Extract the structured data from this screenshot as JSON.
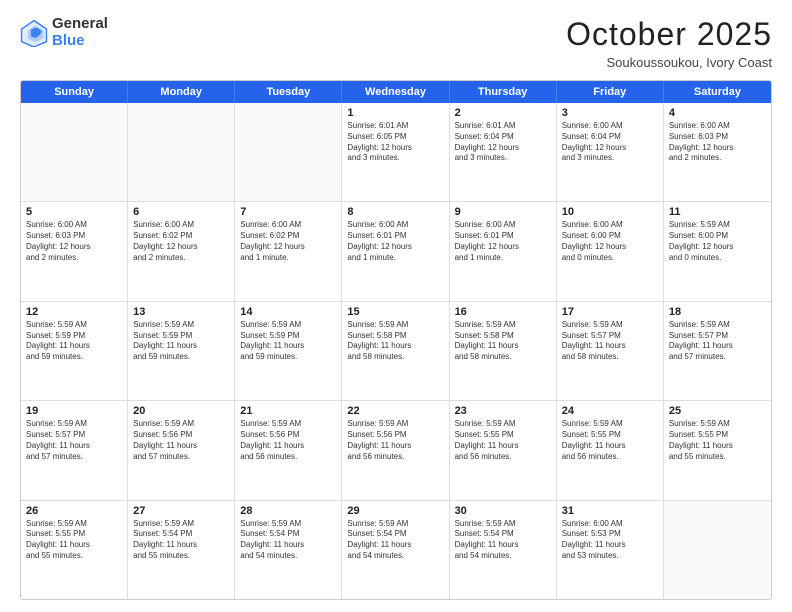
{
  "header": {
    "logo_general": "General",
    "logo_blue": "Blue",
    "month_title": "October 2025",
    "subtitle": "Soukoussoukou, Ivory Coast"
  },
  "weekdays": [
    "Sunday",
    "Monday",
    "Tuesday",
    "Wednesday",
    "Thursday",
    "Friday",
    "Saturday"
  ],
  "rows": [
    [
      {
        "date": "",
        "info": ""
      },
      {
        "date": "",
        "info": ""
      },
      {
        "date": "",
        "info": ""
      },
      {
        "date": "1",
        "info": "Sunrise: 6:01 AM\nSunset: 6:05 PM\nDaylight: 12 hours\nand 3 minutes."
      },
      {
        "date": "2",
        "info": "Sunrise: 6:01 AM\nSunset: 6:04 PM\nDaylight: 12 hours\nand 3 minutes."
      },
      {
        "date": "3",
        "info": "Sunrise: 6:00 AM\nSunset: 6:04 PM\nDaylight: 12 hours\nand 3 minutes."
      },
      {
        "date": "4",
        "info": "Sunrise: 6:00 AM\nSunset: 6:03 PM\nDaylight: 12 hours\nand 2 minutes."
      }
    ],
    [
      {
        "date": "5",
        "info": "Sunrise: 6:00 AM\nSunset: 6:03 PM\nDaylight: 12 hours\nand 2 minutes."
      },
      {
        "date": "6",
        "info": "Sunrise: 6:00 AM\nSunset: 6:02 PM\nDaylight: 12 hours\nand 2 minutes."
      },
      {
        "date": "7",
        "info": "Sunrise: 6:00 AM\nSunset: 6:02 PM\nDaylight: 12 hours\nand 1 minute."
      },
      {
        "date": "8",
        "info": "Sunrise: 6:00 AM\nSunset: 6:01 PM\nDaylight: 12 hours\nand 1 minute."
      },
      {
        "date": "9",
        "info": "Sunrise: 6:00 AM\nSunset: 6:01 PM\nDaylight: 12 hours\nand 1 minute."
      },
      {
        "date": "10",
        "info": "Sunrise: 6:00 AM\nSunset: 6:00 PM\nDaylight: 12 hours\nand 0 minutes."
      },
      {
        "date": "11",
        "info": "Sunrise: 5:59 AM\nSunset: 6:00 PM\nDaylight: 12 hours\nand 0 minutes."
      }
    ],
    [
      {
        "date": "12",
        "info": "Sunrise: 5:59 AM\nSunset: 5:59 PM\nDaylight: 11 hours\nand 59 minutes."
      },
      {
        "date": "13",
        "info": "Sunrise: 5:59 AM\nSunset: 5:59 PM\nDaylight: 11 hours\nand 59 minutes."
      },
      {
        "date": "14",
        "info": "Sunrise: 5:59 AM\nSunset: 5:59 PM\nDaylight: 11 hours\nand 59 minutes."
      },
      {
        "date": "15",
        "info": "Sunrise: 5:59 AM\nSunset: 5:58 PM\nDaylight: 11 hours\nand 58 minutes."
      },
      {
        "date": "16",
        "info": "Sunrise: 5:59 AM\nSunset: 5:58 PM\nDaylight: 11 hours\nand 58 minutes."
      },
      {
        "date": "17",
        "info": "Sunrise: 5:59 AM\nSunset: 5:57 PM\nDaylight: 11 hours\nand 58 minutes."
      },
      {
        "date": "18",
        "info": "Sunrise: 5:59 AM\nSunset: 5:57 PM\nDaylight: 11 hours\nand 57 minutes."
      }
    ],
    [
      {
        "date": "19",
        "info": "Sunrise: 5:59 AM\nSunset: 5:57 PM\nDaylight: 11 hours\nand 57 minutes."
      },
      {
        "date": "20",
        "info": "Sunrise: 5:59 AM\nSunset: 5:56 PM\nDaylight: 11 hours\nand 57 minutes."
      },
      {
        "date": "21",
        "info": "Sunrise: 5:59 AM\nSunset: 5:56 PM\nDaylight: 11 hours\nand 56 minutes."
      },
      {
        "date": "22",
        "info": "Sunrise: 5:59 AM\nSunset: 5:56 PM\nDaylight: 11 hours\nand 56 minutes."
      },
      {
        "date": "23",
        "info": "Sunrise: 5:59 AM\nSunset: 5:55 PM\nDaylight: 11 hours\nand 56 minutes."
      },
      {
        "date": "24",
        "info": "Sunrise: 5:59 AM\nSunset: 5:55 PM\nDaylight: 11 hours\nand 56 minutes."
      },
      {
        "date": "25",
        "info": "Sunrise: 5:59 AM\nSunset: 5:55 PM\nDaylight: 11 hours\nand 55 minutes."
      }
    ],
    [
      {
        "date": "26",
        "info": "Sunrise: 5:59 AM\nSunset: 5:55 PM\nDaylight: 11 hours\nand 55 minutes."
      },
      {
        "date": "27",
        "info": "Sunrise: 5:59 AM\nSunset: 5:54 PM\nDaylight: 11 hours\nand 55 minutes."
      },
      {
        "date": "28",
        "info": "Sunrise: 5:59 AM\nSunset: 5:54 PM\nDaylight: 11 hours\nand 54 minutes."
      },
      {
        "date": "29",
        "info": "Sunrise: 5:59 AM\nSunset: 5:54 PM\nDaylight: 11 hours\nand 54 minutes."
      },
      {
        "date": "30",
        "info": "Sunrise: 5:59 AM\nSunset: 5:54 PM\nDaylight: 11 hours\nand 54 minutes."
      },
      {
        "date": "31",
        "info": "Sunrise: 6:00 AM\nSunset: 5:53 PM\nDaylight: 11 hours\nand 53 minutes."
      },
      {
        "date": "",
        "info": ""
      }
    ]
  ]
}
